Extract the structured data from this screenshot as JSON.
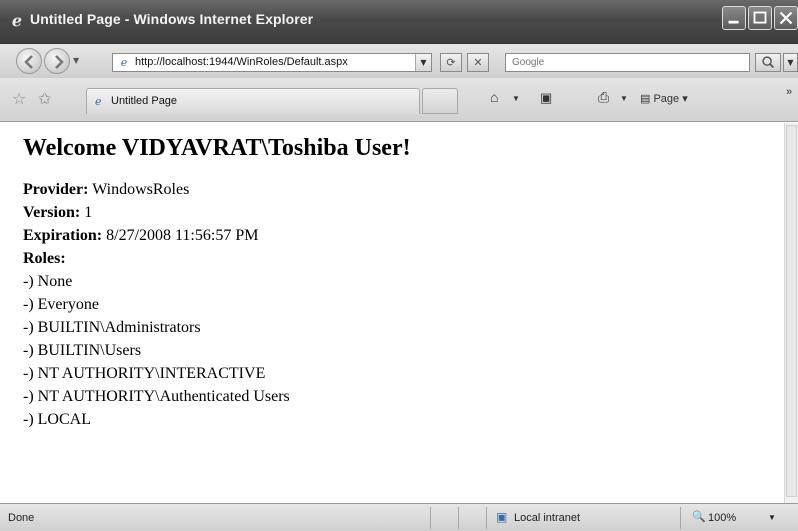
{
  "window": {
    "title": "Untitled Page - Windows Internet Explorer",
    "icon": "ie-icon"
  },
  "navbar": {
    "url": "http://localhost:1944/WinRoles/Default.aspx",
    "search_placeholder": "Google"
  },
  "tabs": [
    {
      "label": "Untitled Page",
      "active": true
    }
  ],
  "toolbar": {
    "page_label": "Page",
    "more": "»"
  },
  "content": {
    "heading": "Welcome VIDYAVRAT\\Toshiba User!",
    "fields": [
      {
        "label": "Provider:",
        "value": "WindowsRoles"
      },
      {
        "label": "Version:",
        "value": "1"
      },
      {
        "label": "Expiration:",
        "value": "8/27/2008 11:56:57 PM"
      }
    ],
    "roles_label": "Roles:",
    "roles": [
      "-) None",
      "-) Everyone",
      "-) BUILTIN\\Administrators",
      "-) BUILTIN\\Users",
      "-) NT AUTHORITY\\INTERACTIVE",
      "-) NT AUTHORITY\\Authenticated Users",
      "-) LOCAL"
    ]
  },
  "statusbar": {
    "status": "Done",
    "zone": "Local intranet",
    "zoom": "100%"
  }
}
